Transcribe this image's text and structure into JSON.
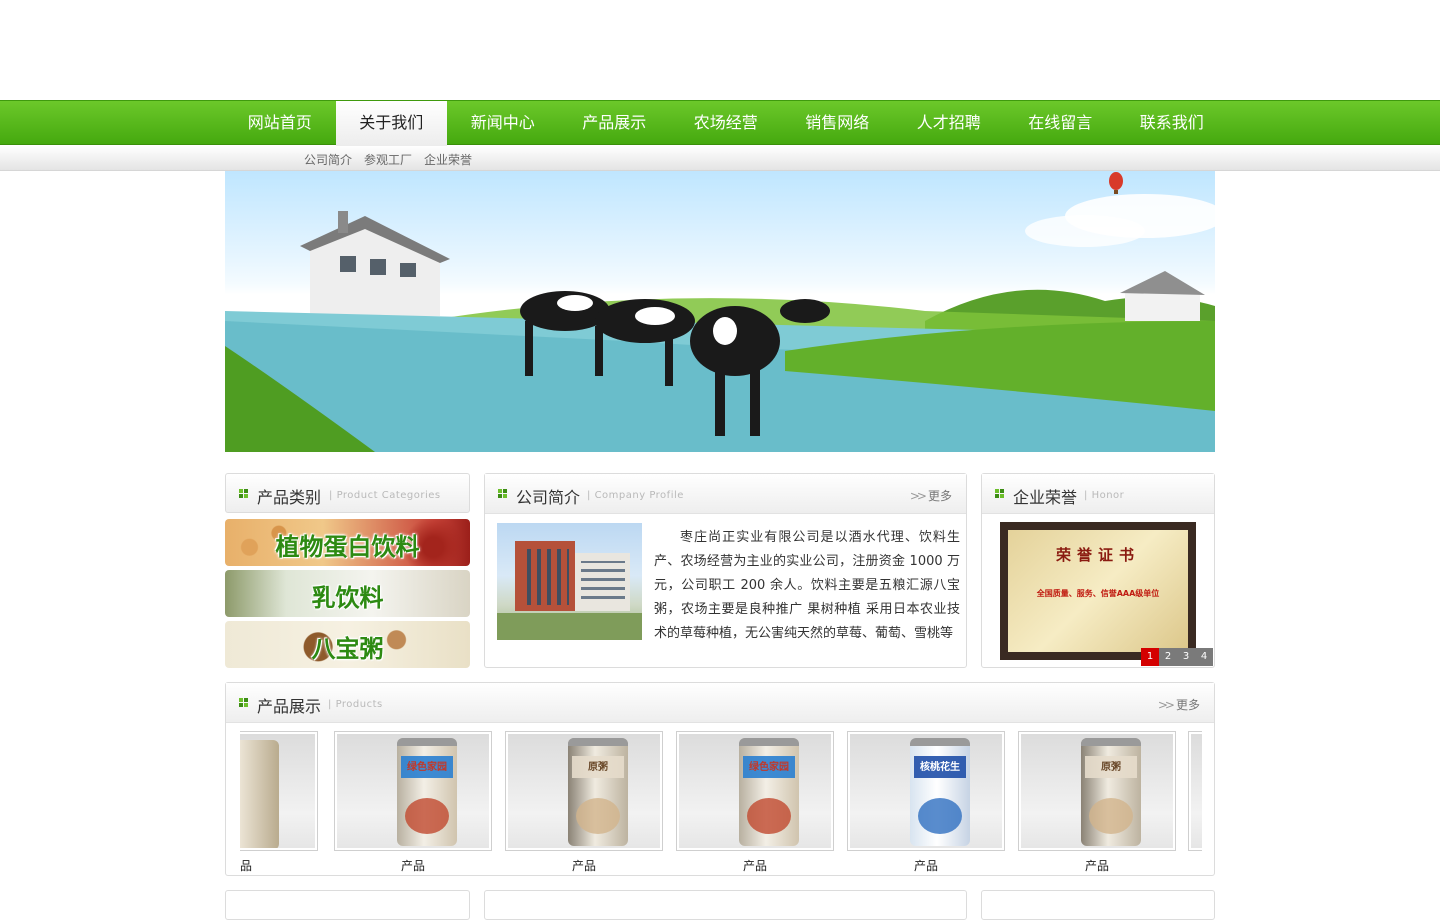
{
  "nav": {
    "items": [
      "网站首页",
      "关于我们",
      "新闻中心",
      "产品展示",
      "农场经营",
      "销售网络",
      "人才招聘",
      "在线留言",
      "联系我们"
    ],
    "active_index": 1,
    "sub_items": [
      "公司简介",
      "参观工厂",
      "企业荣誉"
    ]
  },
  "categories": {
    "title": "产品类别",
    "title_en": "Product Categories",
    "items": [
      "植物蛋白饮料",
      "乳饮料",
      "八宝粥"
    ]
  },
  "profile": {
    "title": "公司简介",
    "title_en": "Company Profile",
    "more": "更多",
    "text": "枣庄尚正实业有限公司是以酒水代理、饮料生产、农场经营为主业的实业公司，注册资金 1000 万元，公司职工 200 余人。饮料主要是五粮汇源八宝粥，农场主要是良种推广 果树种植 采用日本农业技术的草莓种植，无公害纯天然的草莓、葡萄、雪桃等"
  },
  "honor": {
    "title": "企业荣誉",
    "title_en": "Honor",
    "certificate_title": "荣誉证书",
    "certificate_line": "全国质量、服务、信誉AAA级单位",
    "pager": [
      "1",
      "2",
      "3",
      "4"
    ],
    "active_page": 1
  },
  "products": {
    "title": "产品展示",
    "title_en": "Products",
    "more": "更多",
    "first_partial_name": "品",
    "items": [
      {
        "name": "产品",
        "can_text": "绿色家园"
      },
      {
        "name": "产品",
        "can_text": "原粥"
      },
      {
        "name": "产品",
        "can_text": "绿色家园"
      },
      {
        "name": "产品",
        "can_text": "核桃花生"
      },
      {
        "name": "产品",
        "can_text": "原粥"
      }
    ]
  },
  "colors": {
    "nav_green": "#52b51a",
    "category_green": "#2d8a12",
    "pager_active": "#d40000"
  }
}
